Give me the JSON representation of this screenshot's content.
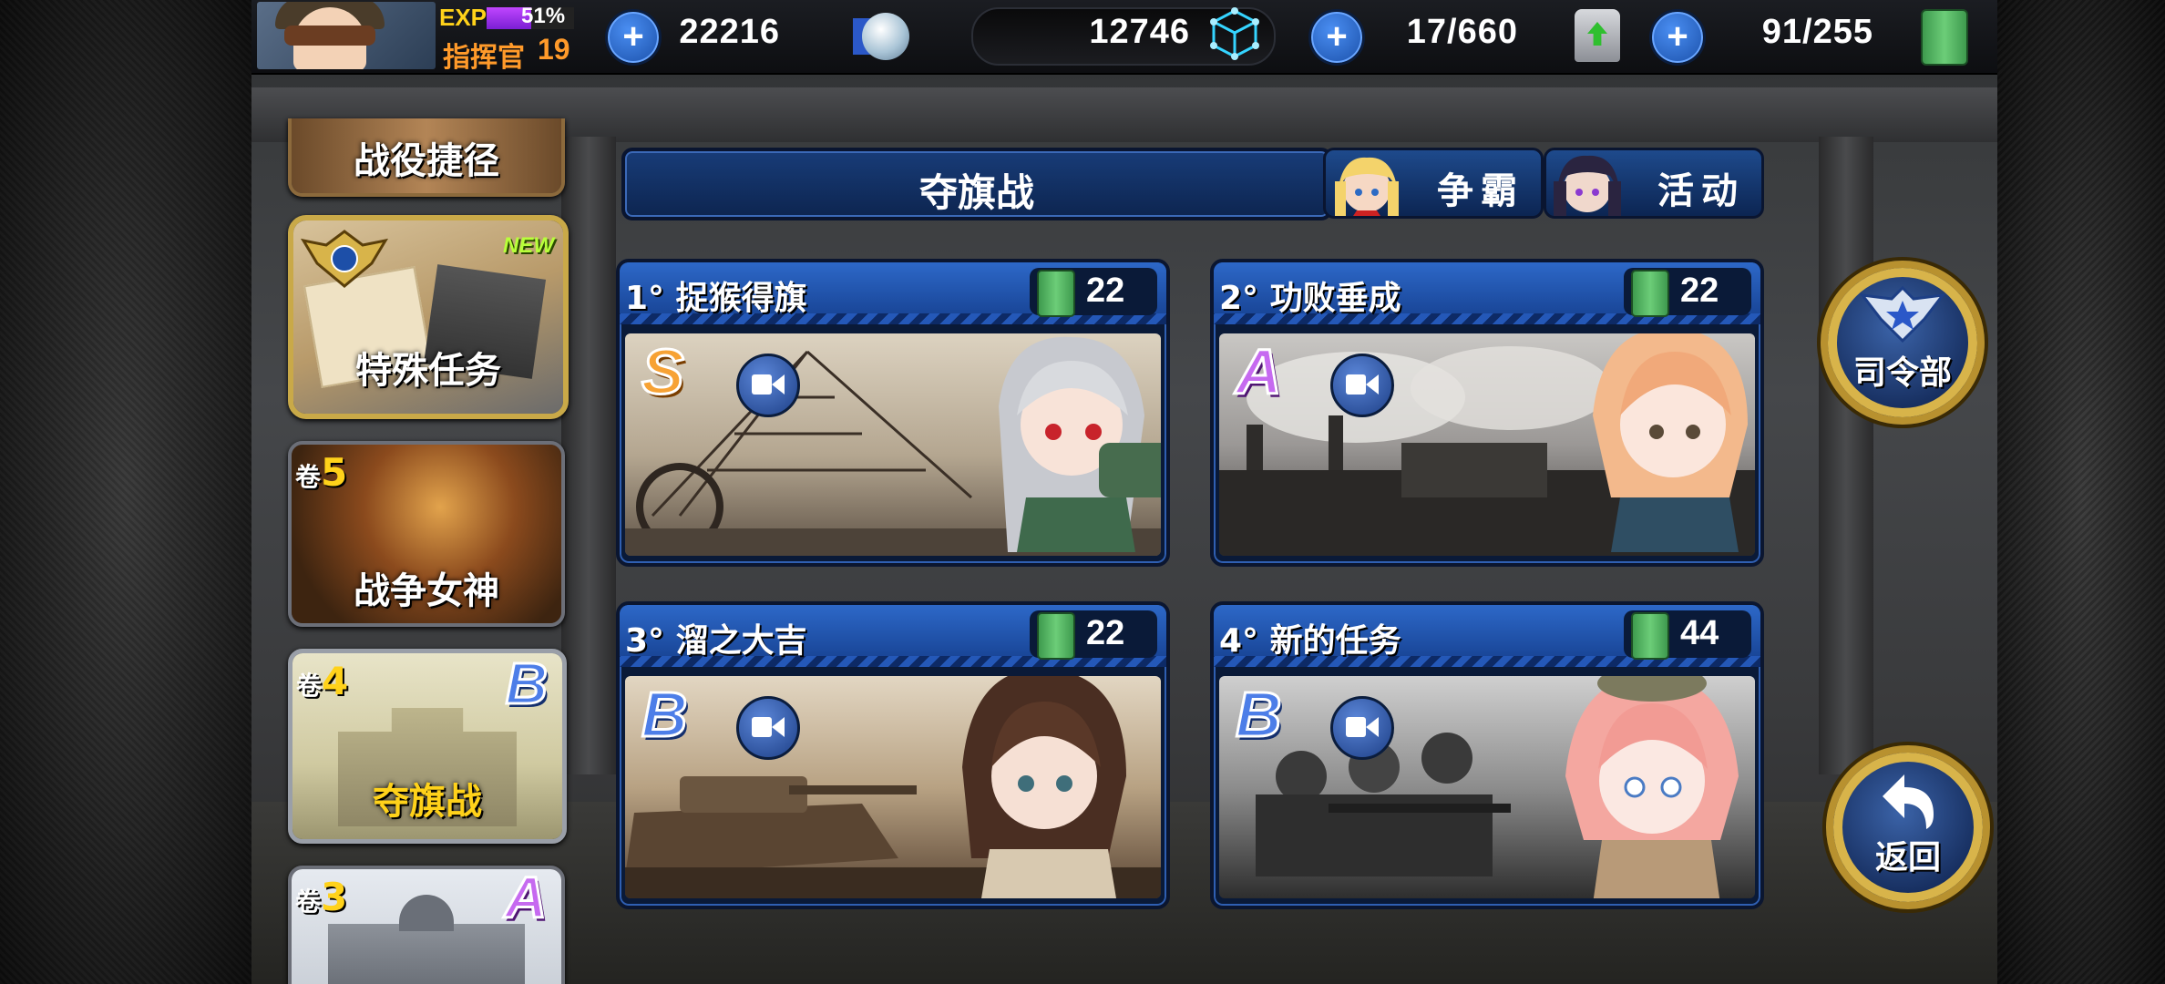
{
  "player": {
    "exp_label": "EXP",
    "exp_percent": "51%",
    "exp_fraction": 0.51,
    "rank_label": "指挥官",
    "level": "19"
  },
  "resources": [
    {
      "icon": "silver-coin-icon",
      "value": "22216"
    },
    {
      "icon": "blue-cube-icon",
      "value": "12746"
    },
    {
      "icon": "paint-bucket-icon",
      "value": "17/660"
    },
    {
      "icon": "fuel-can-icon",
      "value": "91/255"
    }
  ],
  "menu": {
    "items": [
      {
        "label": "战役捷径"
      },
      {
        "label": "特殊任务",
        "badge": "NEW"
      },
      {
        "label": "战争女神",
        "vol_prefix": "卷",
        "vol_num": "5"
      },
      {
        "label": "夺旗战",
        "vol_prefix": "卷",
        "vol_num": "4",
        "grade": "B"
      },
      {
        "label": "",
        "vol_prefix": "卷",
        "vol_num": "3",
        "grade": "A"
      }
    ]
  },
  "header": {
    "title": "夺旗战",
    "tab1": "争霸",
    "tab2": "活动"
  },
  "missions": [
    {
      "name": "1°  捉猴得旗",
      "cost": "22",
      "grade": "S"
    },
    {
      "name": "2°  功败垂成",
      "cost": "22",
      "grade": "A"
    },
    {
      "name": "3°  溜之大吉",
      "cost": "22",
      "grade": "B"
    },
    {
      "name": "4°  新的任务",
      "cost": "44",
      "grade": "B"
    }
  ],
  "buttons": {
    "hq": "司令部",
    "back": "返回"
  },
  "colors": {
    "accent_blue": "#1d4fa8",
    "gold": "#d8b44a",
    "grade_s": "#f7a234",
    "grade_a": "#c66af0",
    "grade_b": "#4d7ee8"
  }
}
